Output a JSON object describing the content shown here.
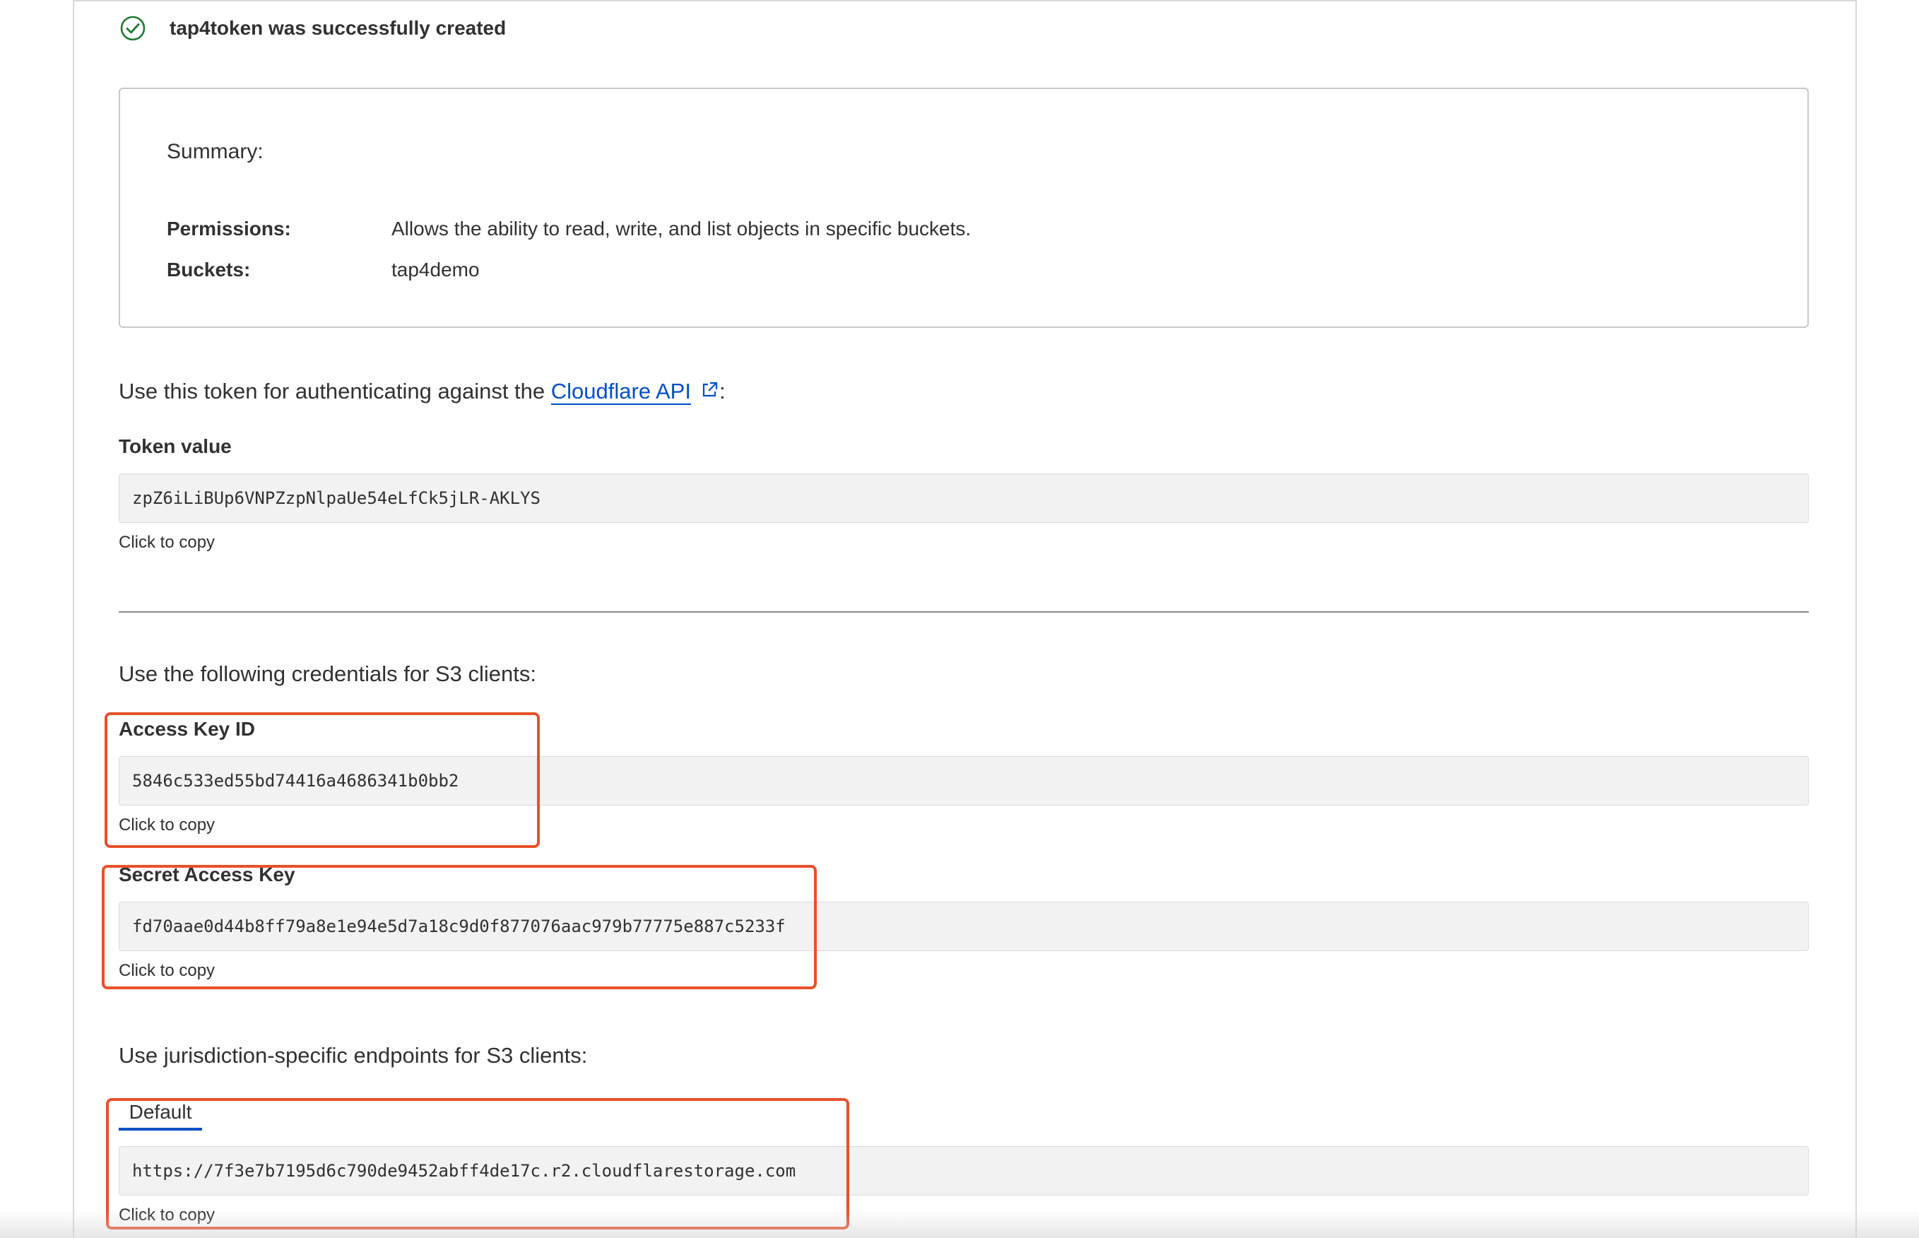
{
  "success": {
    "message": "tap4token was successfully created",
    "icon": "check-circle-icon",
    "icon_color": "#1e7a34"
  },
  "summary": {
    "title": "Summary:",
    "permissions_label": "Permissions:",
    "permissions_value": "Allows the ability to read, write, and list objects in specific buckets.",
    "buckets_label": "Buckets:",
    "buckets_value": "tap4demo"
  },
  "api_token": {
    "intro_prefix": "Use this token for authenticating against the ",
    "link_text": "Cloudflare API",
    "link_icon": "external-link-icon",
    "intro_suffix": ":",
    "label": "Token value",
    "value": "zpZ6iLiBUp6VNPZzpNlpaUe54eLfCk5jLR-AKLYS",
    "copy_hint": "Click to copy"
  },
  "s3_credentials": {
    "heading": "Use the following credentials for S3 clients:",
    "access_key_label": "Access Key ID",
    "access_key_value": "5846c533ed55bd74416a4686341b0bb2",
    "access_key_copy": "Click to copy",
    "secret_key_label": "Secret Access Key",
    "secret_key_value": "fd70aae0d44b8ff79a8e1e94e5d7a18c9d0f877076aac979b77775e887c5233f",
    "secret_key_copy": "Click to copy"
  },
  "endpoints": {
    "heading": "Use jurisdiction-specific endpoints for S3 clients:",
    "tab_label": "Default",
    "value": "https://7f3e7b7195d6c790de9452abff4de17c.r2.cloudflarestorage.com",
    "copy_hint": "Click to copy"
  },
  "colors": {
    "link": "#0051c3",
    "annotation": "#e8512a",
    "field_background": "#f2f2f2"
  }
}
